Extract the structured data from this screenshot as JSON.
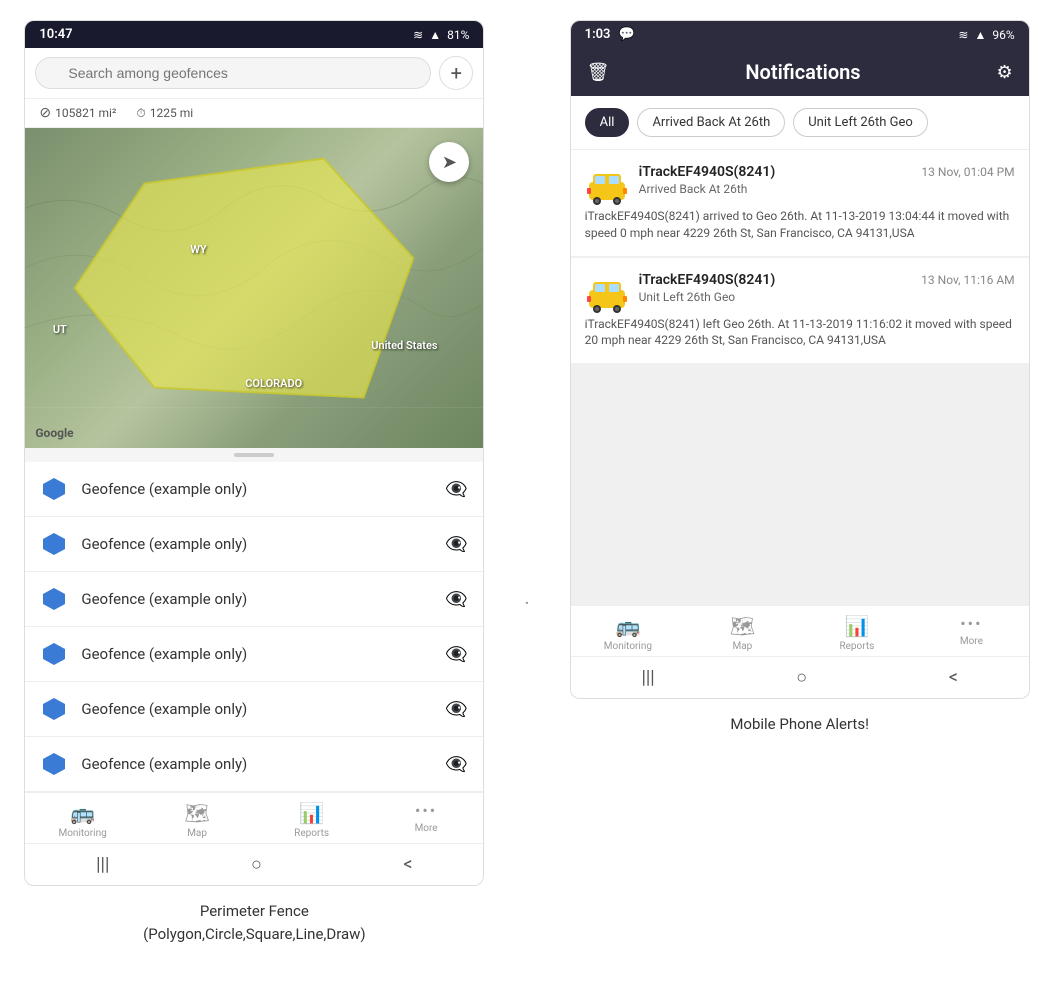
{
  "left_phone": {
    "status_bar": {
      "time": "10:47",
      "signal": "📶",
      "wifi": "WiFi",
      "battery": "81%"
    },
    "search": {
      "placeholder": "Search among geofences"
    },
    "stats": {
      "area": "105821 mi²",
      "distance": "1225 mi"
    },
    "map": {
      "labels": {
        "wy": "WY",
        "co": "COLORADO",
        "us": "United States",
        "ut": "UT"
      },
      "google": "Google"
    },
    "geofence_items": [
      {
        "label": "Geofence (example only)"
      },
      {
        "label": "Geofence (example only)"
      },
      {
        "label": "Geofence (example only)"
      },
      {
        "label": "Geofence (example only)"
      },
      {
        "label": "Geofence (example only)"
      },
      {
        "label": "Geofence (example only)"
      }
    ],
    "bottom_nav": [
      {
        "label": "Monitoring",
        "icon": "🚌"
      },
      {
        "label": "Map",
        "icon": "🗺"
      },
      {
        "label": "Reports",
        "icon": "📊"
      },
      {
        "label": "More",
        "icon": "···"
      }
    ],
    "nav_buttons": [
      "|||",
      "○",
      "<"
    ],
    "caption": "Perimeter Fence\n(Polygon,Circle,Square,Line,Draw)"
  },
  "divider": ".",
  "right_phone": {
    "status_bar": {
      "time": "1:03",
      "chat_icon": "💬",
      "signal": "📶",
      "battery": "96%"
    },
    "header": {
      "title": "Notifications",
      "delete_icon": "🗑",
      "settings_icon": "⚙"
    },
    "filter_tabs": [
      {
        "label": "All",
        "active": true
      },
      {
        "label": "Arrived Back At 26th",
        "active": false
      },
      {
        "label": "Unit Left 26th Geo",
        "active": false
      }
    ],
    "notifications": [
      {
        "device": "iTrackEF4940S(8241)",
        "time": "13 Nov, 01:04 PM",
        "event": "Arrived Back At 26th",
        "detail": "iTrackEF4940S(8241) arrived to Geo 26th.    At 11-13-2019 13:04:44 it moved with speed 0 mph near 4229 26th St, San Francisco, CA 94131,USA"
      },
      {
        "device": "iTrackEF4940S(8241)",
        "time": "13 Nov, 11:16 AM",
        "event": "Unit Left 26th Geo",
        "detail": "iTrackEF4940S(8241) left Geo 26th.    At 11-13-2019 11:16:02 it moved with speed 20 mph near 4229 26th St, San Francisco, CA 94131,USA"
      }
    ],
    "bottom_nav": [
      {
        "label": "Monitoring",
        "icon": "🚌"
      },
      {
        "label": "Map",
        "icon": "🗺"
      },
      {
        "label": "Reports",
        "icon": "📊"
      },
      {
        "label": "More",
        "icon": "···"
      }
    ],
    "nav_buttons": [
      "|||",
      "○",
      "<"
    ],
    "caption": "Mobile Phone Alerts!"
  }
}
